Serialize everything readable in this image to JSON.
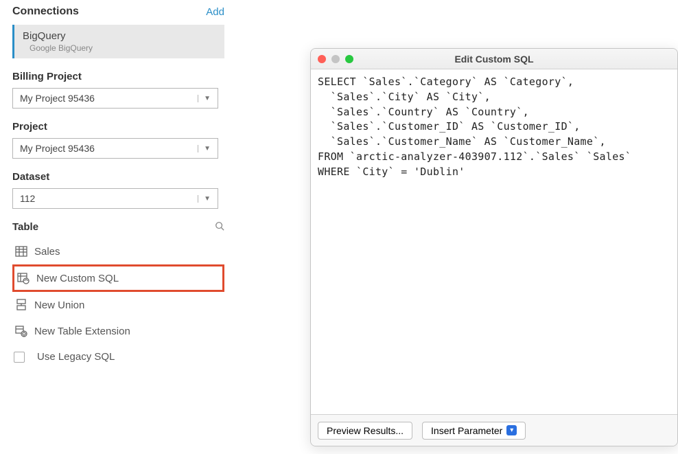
{
  "sidebar": {
    "connections_label": "Connections",
    "add_label": "Add",
    "active_connection": {
      "name": "BigQuery",
      "subtitle": "Google BigQuery"
    },
    "billing_project": {
      "label": "Billing Project",
      "value": "My Project 95436"
    },
    "project": {
      "label": "Project",
      "value": "My Project 95436"
    },
    "dataset": {
      "label": "Dataset",
      "value": "112"
    },
    "table_label": "Table",
    "tables": [
      {
        "label": "Sales",
        "icon": "table-icon"
      }
    ],
    "actions": [
      {
        "label": "New Custom SQL",
        "icon": "custom-sql-icon",
        "highlight": true
      },
      {
        "label": "New Union",
        "icon": "union-icon",
        "highlight": false
      },
      {
        "label": "New Table Extension",
        "icon": "extension-icon",
        "highlight": false
      }
    ],
    "legacy_checkbox_label": "Use Legacy SQL"
  },
  "dialog": {
    "title": "Edit Custom SQL",
    "sql": "SELECT `Sales`.`Category` AS `Category`,\n  `Sales`.`City` AS `City`,\n  `Sales`.`Country` AS `Country`,\n  `Sales`.`Customer_ID` AS `Customer_ID`,\n  `Sales`.`Customer_Name` AS `Customer_Name`,\nFROM `arctic-analyzer-403907.112`.`Sales` `Sales`\nWHERE `City` = 'Dublin'",
    "preview_button": "Preview Results...",
    "insert_button": "Insert Parameter"
  }
}
